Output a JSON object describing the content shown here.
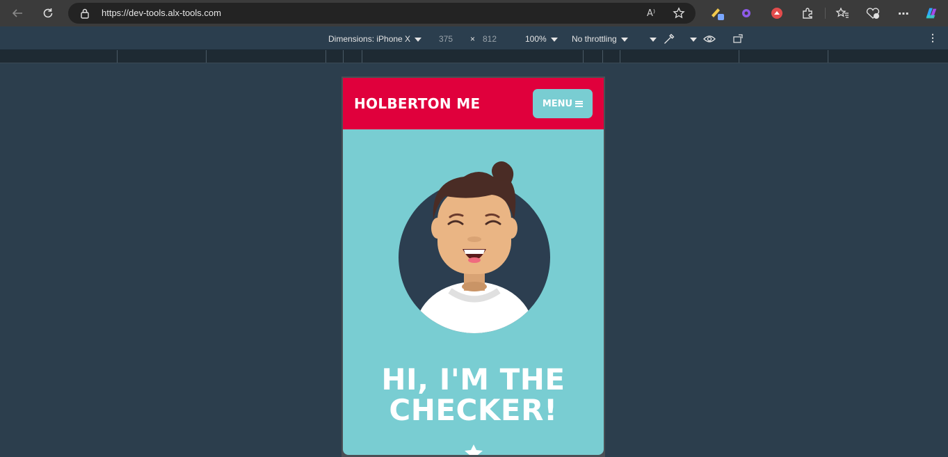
{
  "browser": {
    "url": "https://dev-tools.alx-tools.com",
    "read_aloud_label": "A⁾",
    "extensions": [
      "color-picker-extension",
      "gear-extension",
      "cloud-extension",
      "puzzle-extension"
    ]
  },
  "device_toolbar": {
    "dimensions_label": "Dimensions: iPhone X",
    "width": "375",
    "times": "×",
    "height": "812",
    "zoom": "100%",
    "throttling": "No throttling"
  },
  "site": {
    "logo": "HOLBERTON ME",
    "menu_label": "MENU",
    "hero_line1": "HI, I'M THE",
    "hero_line2": "CHECKER!",
    "colors": {
      "header": "#e0003c",
      "background": "#79cdd2",
      "avatar_circle": "#2c3e50"
    }
  }
}
